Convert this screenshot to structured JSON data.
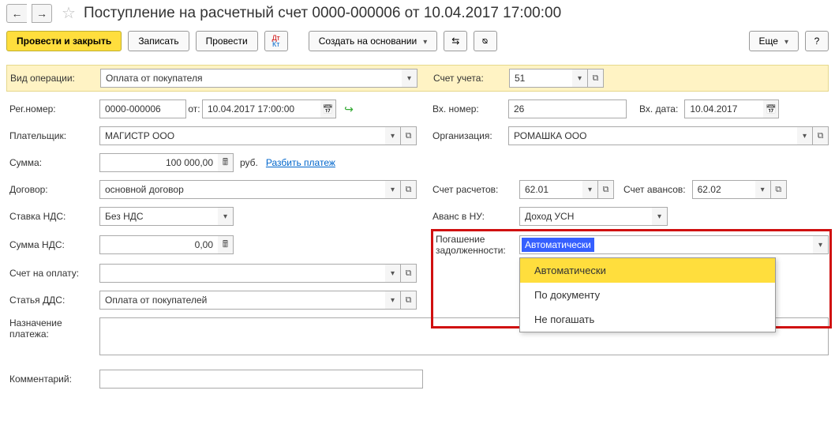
{
  "nav": {
    "back": "←",
    "fwd": "→"
  },
  "title": "Поступление на расчетный счет 0000-000006 от 10.04.2017 17:00:00",
  "toolbar": {
    "post_close": "Провести и закрыть",
    "save": "Записать",
    "post": "Провести",
    "create_based": "Создать на основании",
    "more": "Еще"
  },
  "labels": {
    "op_type": "Вид операции:",
    "account": "Счет учета:",
    "reg_no": "Рег.номер:",
    "from": "от:",
    "in_no": "Вх. номер:",
    "in_date": "Вх. дата:",
    "payer": "Плательщик:",
    "org": "Организация:",
    "sum": "Сумма:",
    "currency": "руб.",
    "split": "Разбить платеж",
    "contract": "Договор:",
    "settle_acc": "Счет расчетов:",
    "advance_acc": "Счет авансов:",
    "vat_rate": "Ставка НДС:",
    "advance_nu": "Аванс в НУ:",
    "vat_sum": "Сумма НДС:",
    "debt_repay": "Погашение задолженности:",
    "invoice": "Счет на оплату:",
    "dds": "Статья ДДС:",
    "purpose": "Назначение платежа:",
    "comment": "Комментарий:"
  },
  "values": {
    "op_type": "Оплата от покупателя",
    "account": "51",
    "reg_no": "0000-000006",
    "date": "10.04.2017 17:00:00",
    "in_no": "26",
    "in_date": "10.04.2017",
    "payer": "МАГИСТР ООО",
    "org": "РОМАШКА ООО",
    "sum": "100 000,00",
    "contract": "основной договор",
    "settle_acc": "62.01",
    "advance_acc": "62.02",
    "vat_rate": "Без НДС",
    "advance_nu": "Доход УСН",
    "vat_sum": "0,00",
    "debt_repay": "Автоматически",
    "invoice": "",
    "dds": "Оплата от покупателей",
    "purpose": "",
    "comment": ""
  },
  "dropdown": {
    "opt1": "Автоматически",
    "opt2": "По документу",
    "opt3": "Не погашать"
  }
}
